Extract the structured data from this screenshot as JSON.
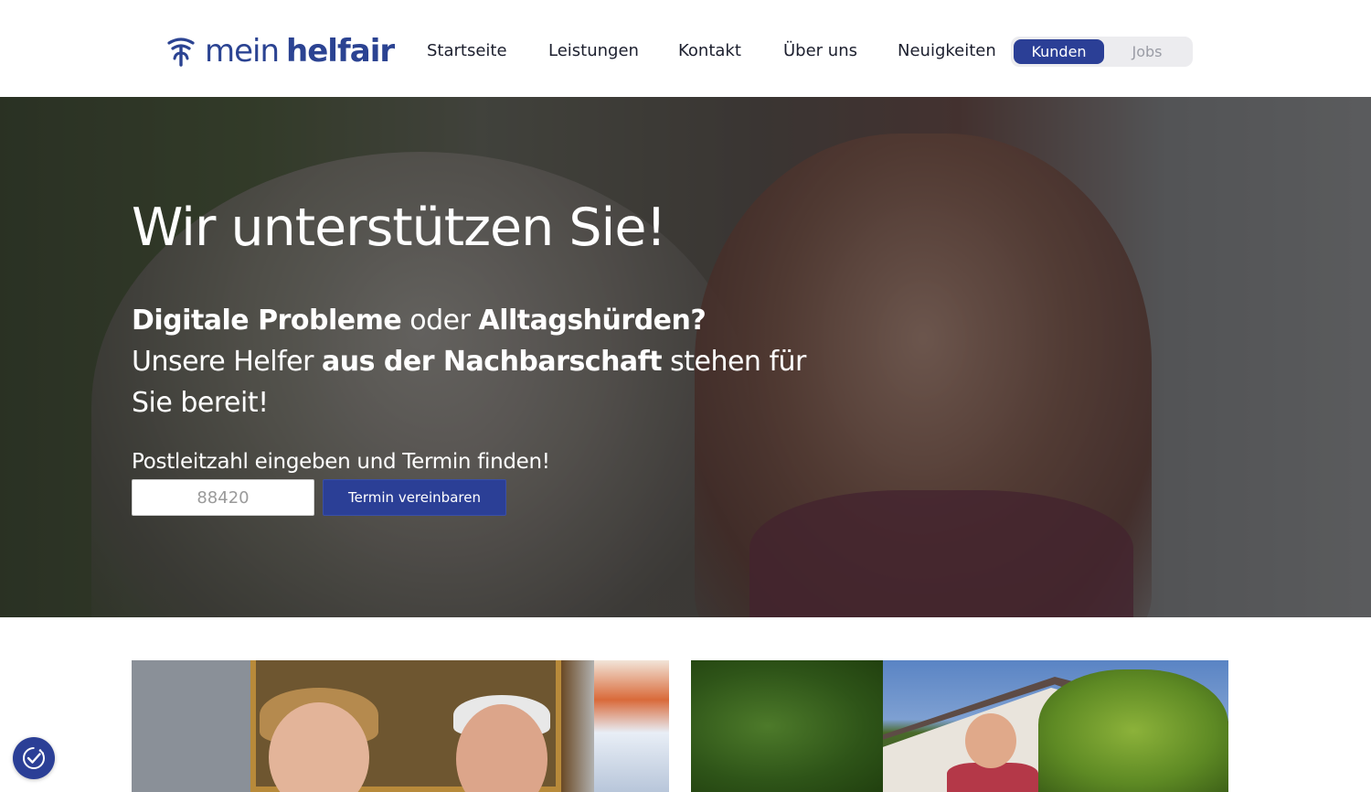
{
  "brand": {
    "name_part1": "mein",
    "name_part2": "helfair",
    "color": "#2b4392"
  },
  "nav": {
    "items": [
      {
        "label": "Startseite"
      },
      {
        "label": "Leistungen"
      },
      {
        "label": "Kontakt"
      },
      {
        "label": "Über uns"
      },
      {
        "label": "Neuigkeiten"
      }
    ]
  },
  "audience_toggle": {
    "active": "Kunden",
    "inactive": "Jobs",
    "accent": "#2b3f96"
  },
  "hero": {
    "title": "Wir unterstützen Sie!",
    "lead": {
      "part1_bold": "Digitale Probleme",
      "part2": " oder ",
      "part3_bold": "Alltagshürden?",
      "part4": "Unsere Helfer ",
      "part5_bold": "aus der Nachbarschaft",
      "part6": " stehen für Sie bereit!"
    },
    "cta_label": "Postleitzahl eingeben und Termin finden!",
    "zip_placeholder": "88420",
    "zip_value": "",
    "cta_button": "Termin vereinbaren"
  },
  "accessibility": {
    "icon": "accessibility-check-icon"
  }
}
